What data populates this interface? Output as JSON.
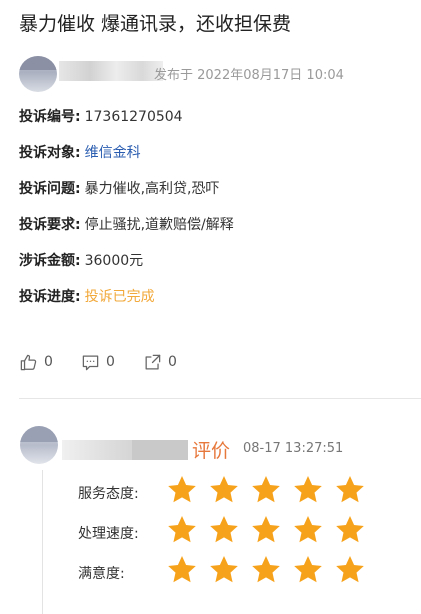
{
  "title": "暴力催收 爆通讯录，还收担保费",
  "post": {
    "date": "发布于 2022年08月17日 10:04"
  },
  "fields": [
    {
      "label": "投诉编号:",
      "value": "17361270504",
      "kind": "plain"
    },
    {
      "label": "投诉对象:",
      "value": "维信金科",
      "kind": "link"
    },
    {
      "label": "投诉问题:",
      "value": "暴力催收,高利贷,恐吓",
      "kind": "plain"
    },
    {
      "label": "投诉要求:",
      "value": "停止骚扰,道歉赔偿/解释",
      "kind": "plain"
    },
    {
      "label": "涉诉金额:",
      "value": "36000元",
      "kind": "plain"
    },
    {
      "label": "投诉进度:",
      "value": "投诉已完成",
      "kind": "status"
    }
  ],
  "actions": {
    "like_count": "0",
    "comment_count": "0",
    "share_count": "0"
  },
  "review": {
    "label": "评价",
    "time": "08-17 13:27:51",
    "ratings": [
      {
        "label": "服务态度:",
        "stars": 5,
        "max": 5
      },
      {
        "label": "处理速度:",
        "stars": 5,
        "max": 5
      },
      {
        "label": "满意度:",
        "stars": 5,
        "max": 5
      }
    ]
  },
  "colors": {
    "link": "#2a5db0",
    "status": "#f2a93b",
    "review_label": "#e7783c",
    "star": "#f7a21b"
  },
  "icons": {
    "like": "thumbs-up-icon",
    "comment": "comment-icon",
    "share": "share-icon",
    "star": "star-icon"
  }
}
